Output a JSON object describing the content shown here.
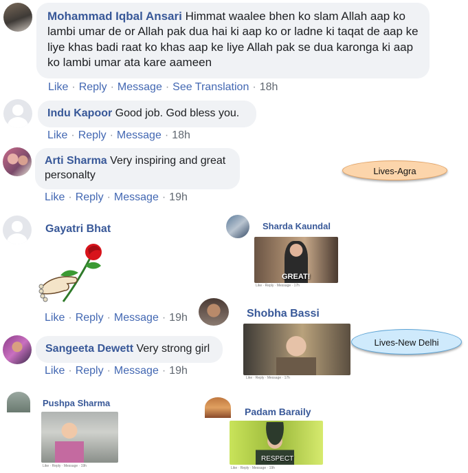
{
  "comments": {
    "c1": {
      "name": "Mohammad Iqbal Ansari",
      "text": " Himmat waalee bhen ko slam Allah aap ko lambi umar de or Allah pak dua hai ki aap ko or ladne ki taqat de aap ke liye khas badi raat ko khas aap ke liye Allah pak se dua karonga ki aap ko lambi umar ata kare aameen",
      "like": "Like",
      "reply": "Reply",
      "message": "Message",
      "translate": "See Translation",
      "time": "18h"
    },
    "c2": {
      "name": "Indu Kapoor",
      "text": " Good job. God bless you.",
      "like": "Like",
      "reply": "Reply",
      "message": "Message",
      "time": "18h"
    },
    "c3": {
      "name": "Arti Sharma",
      "text": " Very inspiring and great personalty",
      "like": "Like",
      "reply": "Reply",
      "message": "Message",
      "time": "19h"
    },
    "c4": {
      "name": "Gayatri Bhat",
      "like": "Like",
      "reply": "Reply",
      "message": "Message",
      "time": "19h"
    },
    "c5": {
      "name": "Sangeeta Dewett",
      "text": " Very strong girl",
      "like": "Like",
      "reply": "Reply",
      "message": "Message",
      "time": "19h"
    },
    "c6": {
      "name": "Pushpa Sharma",
      "tiny": "Like · Reply · Message · 19h"
    },
    "c7": {
      "name": "Sharda Kaundal",
      "gif_caption": "GREAT!",
      "tiny": "Like · Reply · Message · 17h"
    },
    "c8": {
      "name": "Shobha Bassi",
      "tiny": "Like · Reply · Message · 17h"
    },
    "c9": {
      "name": "Padam Baraily",
      "gif_caption": "RESPECT",
      "tiny": "Like · Reply · Message · 19h"
    }
  },
  "tags": {
    "agra": "Lives-Agra",
    "delhi": "Lives-New Delhi"
  },
  "colors": {
    "name": "#385898",
    "action": "#4267b2",
    "bubble": "#f0f2f5",
    "pill_orange": "#fcd5ab",
    "pill_blue": "#cfeafc"
  }
}
